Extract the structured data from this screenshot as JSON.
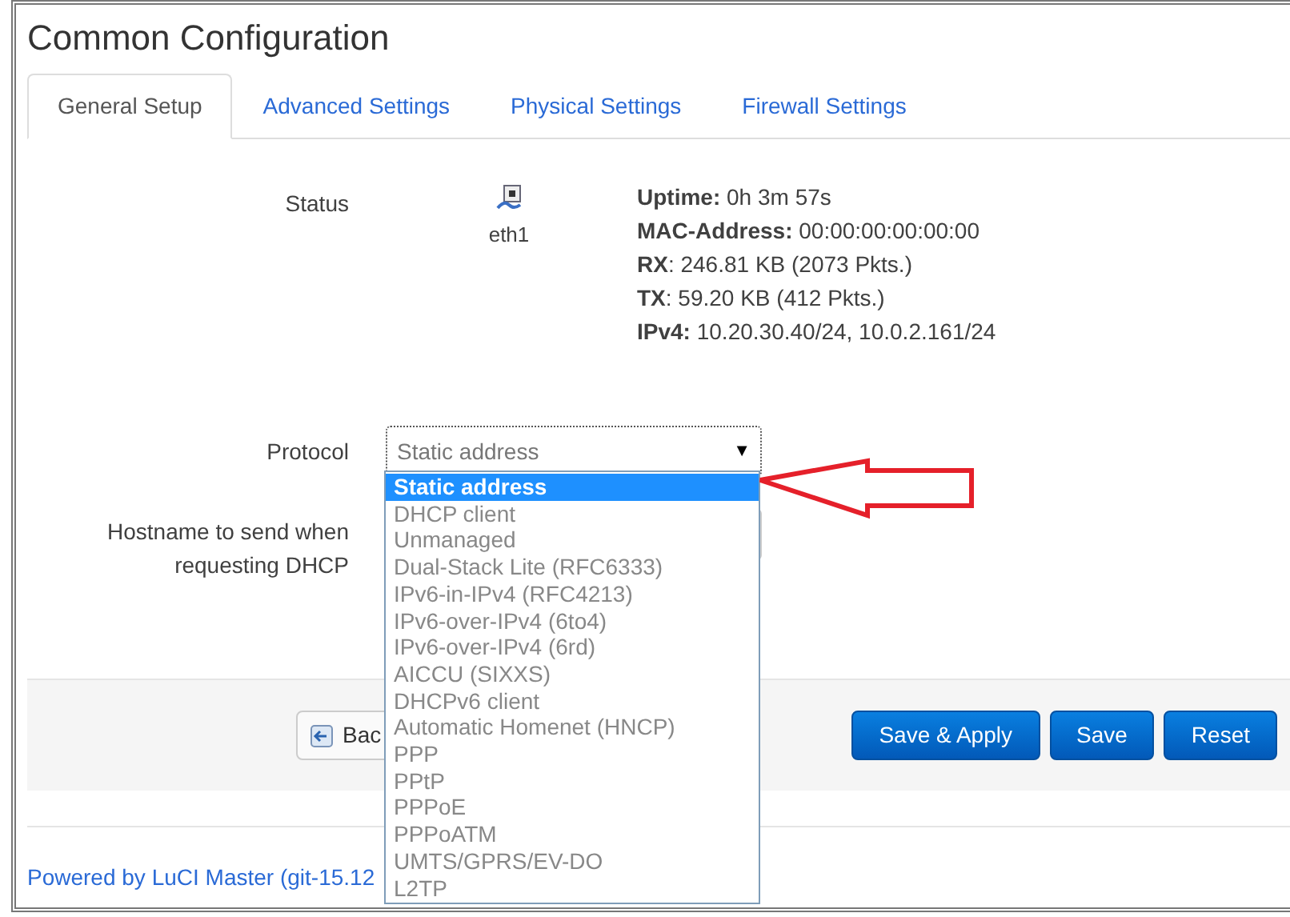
{
  "title": "Common Configuration",
  "tabs": [
    {
      "label": "General Setup",
      "selected": true
    },
    {
      "label": "Advanced Settings",
      "selected": false
    },
    {
      "label": "Physical Settings",
      "selected": false
    },
    {
      "label": "Firewall Settings",
      "selected": false
    }
  ],
  "status": {
    "label": "Status",
    "device": "eth1",
    "lines": [
      "**Uptime:** 0h 3m 57s",
      "**MAC-Address:** 00:00:00:00:00:00",
      "**RX**: 246.81 KB (2073 Pkts.)",
      "**TX**: 59.20 KB (412 Pkts.)",
      "**IPv4:** 10.20.30.40/24, 10.0.2.161/24"
    ]
  },
  "protocol": {
    "label": "Protocol",
    "value": "Static address",
    "caret": "▼",
    "expanded": true,
    "options": [
      {
        "label": "Static address",
        "selected": true
      },
      {
        "label": "DHCP client",
        "selected": false
      },
      {
        "label": "Unmanaged",
        "selected": false
      },
      {
        "label": "Dual-Stack Lite (RFC6333)",
        "selected": false
      },
      {
        "label": "IPv6-in-IPv4 (RFC4213)",
        "selected": false
      },
      {
        "label": "IPv6-over-IPv4 (6to4)",
        "selected": false
      },
      {
        "label": "IPv6-over-IPv4 (6rd)",
        "selected": false
      },
      {
        "label": "AICCU (SIXXS)",
        "selected": false
      },
      {
        "label": "DHCPv6 client",
        "selected": false
      },
      {
        "label": "Automatic Homenet (HNCP)",
        "selected": false
      },
      {
        "label": "PPP",
        "selected": false
      },
      {
        "label": "PPtP",
        "selected": false
      },
      {
        "label": "PPPoE",
        "selected": false
      },
      {
        "label": "PPPoATM",
        "selected": false
      },
      {
        "label": "UMTS/GPRS/EV-DO",
        "selected": false
      },
      {
        "label": "L2TP",
        "selected": false
      }
    ]
  },
  "hostname": {
    "label": "Hostname to send when requesting DHCP"
  },
  "actions": {
    "back": "Bac",
    "buttons": [
      "Save & Apply",
      "Save",
      "Reset"
    ]
  },
  "footer": "Powered by LuCI Master (git-15.12"
}
